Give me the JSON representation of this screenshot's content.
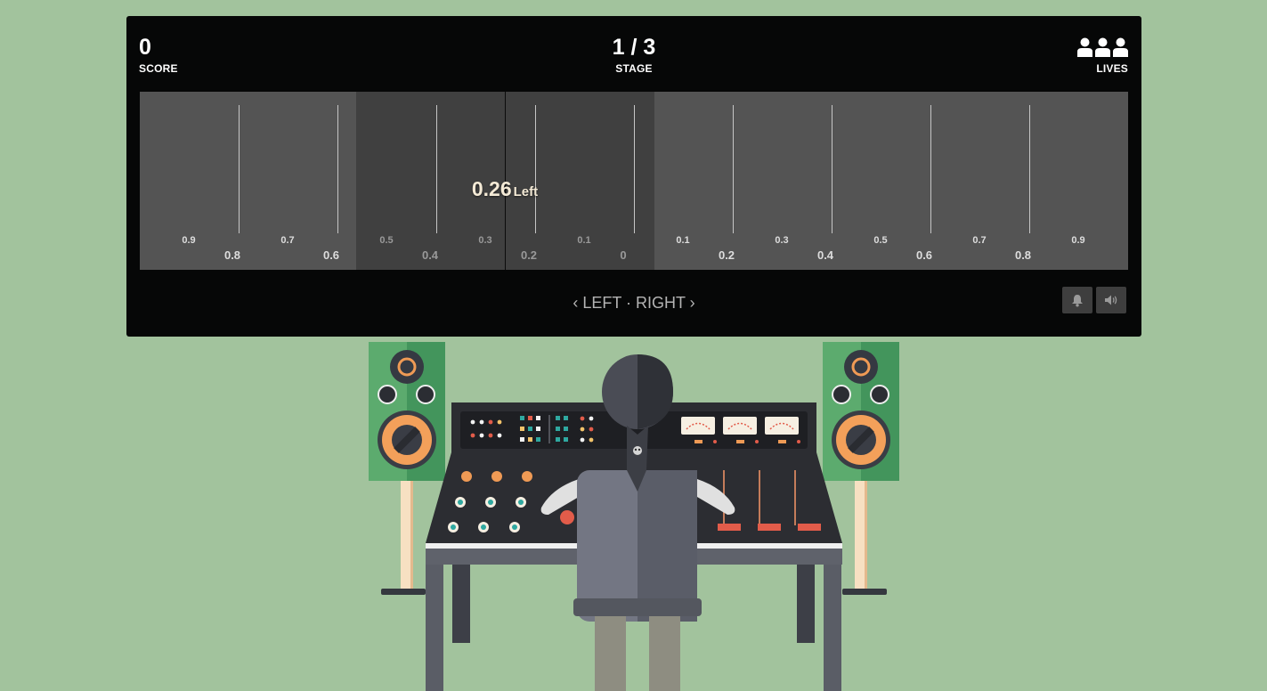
{
  "hud": {
    "score_value": "0",
    "score_label": "SCORE",
    "stage_value": "1 / 3",
    "stage_label": "STAGE",
    "lives_label": "LIVES",
    "lives_count": 3
  },
  "scale": {
    "minor_ticks": [
      "0.9",
      "0.7",
      "0.5",
      "0.3",
      "0.1",
      "0.1",
      "0.3",
      "0.5",
      "0.7",
      "0.9"
    ],
    "major_ticks": [
      "0.8",
      "0.6",
      "0.4",
      "0.2",
      "0",
      "0.2",
      "0.4",
      "0.6",
      "0.8"
    ],
    "readout_value": "0.26",
    "readout_direction": "Left"
  },
  "hint": "‹ LEFT · RIGHT ›",
  "icons": {
    "lives": "person-icon",
    "bell": "bell-icon",
    "sound": "speaker-icon"
  },
  "colors": {
    "background": "#a2c39d",
    "panel": "#060707",
    "scale_bg": "#545454",
    "zone": "#404040",
    "readout": "#f4ead6"
  }
}
